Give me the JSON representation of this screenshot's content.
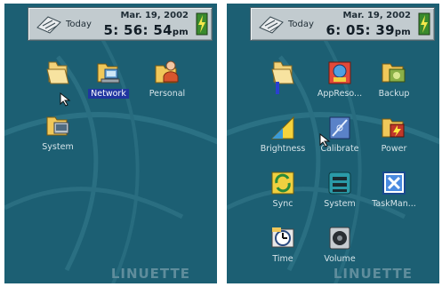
{
  "left": {
    "topbar": {
      "today_label": "Today",
      "date": "Mar. 19, 2002",
      "time": "5: 56: 54",
      "ampm": "pm"
    },
    "icons": [
      {
        "label": "",
        "icon": "folder-icon",
        "selected": false
      },
      {
        "label": "Network",
        "icon": "network-icon",
        "selected": true
      },
      {
        "label": "Personal",
        "icon": "personal-icon",
        "selected": false
      },
      {
        "label": "System",
        "icon": "system-icon",
        "selected": false
      }
    ],
    "watermark": "LINUETTE"
  },
  "right": {
    "topbar": {
      "today_label": "Today",
      "date": "Mar. 19, 2002",
      "time": "6: 05: 39",
      "ampm": "pm"
    },
    "icons": [
      {
        "label": "",
        "icon": "folder-icon"
      },
      {
        "label": "AppReso...",
        "icon": "appresource-icon"
      },
      {
        "label": "Backup",
        "icon": "backup-icon"
      },
      {
        "label": "Brightness",
        "icon": "brightness-icon"
      },
      {
        "label": "Calibrate",
        "icon": "calibrate-icon"
      },
      {
        "label": "Power",
        "icon": "power-icon"
      },
      {
        "label": "Sync",
        "icon": "sync-icon"
      },
      {
        "label": "System",
        "icon": "system-icon"
      },
      {
        "label": "TaskMan...",
        "icon": "taskman-icon"
      },
      {
        "label": "Time",
        "icon": "time-icon"
      },
      {
        "label": "Volume",
        "icon": "volume-icon"
      }
    ],
    "watermark": "LINUETTE"
  }
}
